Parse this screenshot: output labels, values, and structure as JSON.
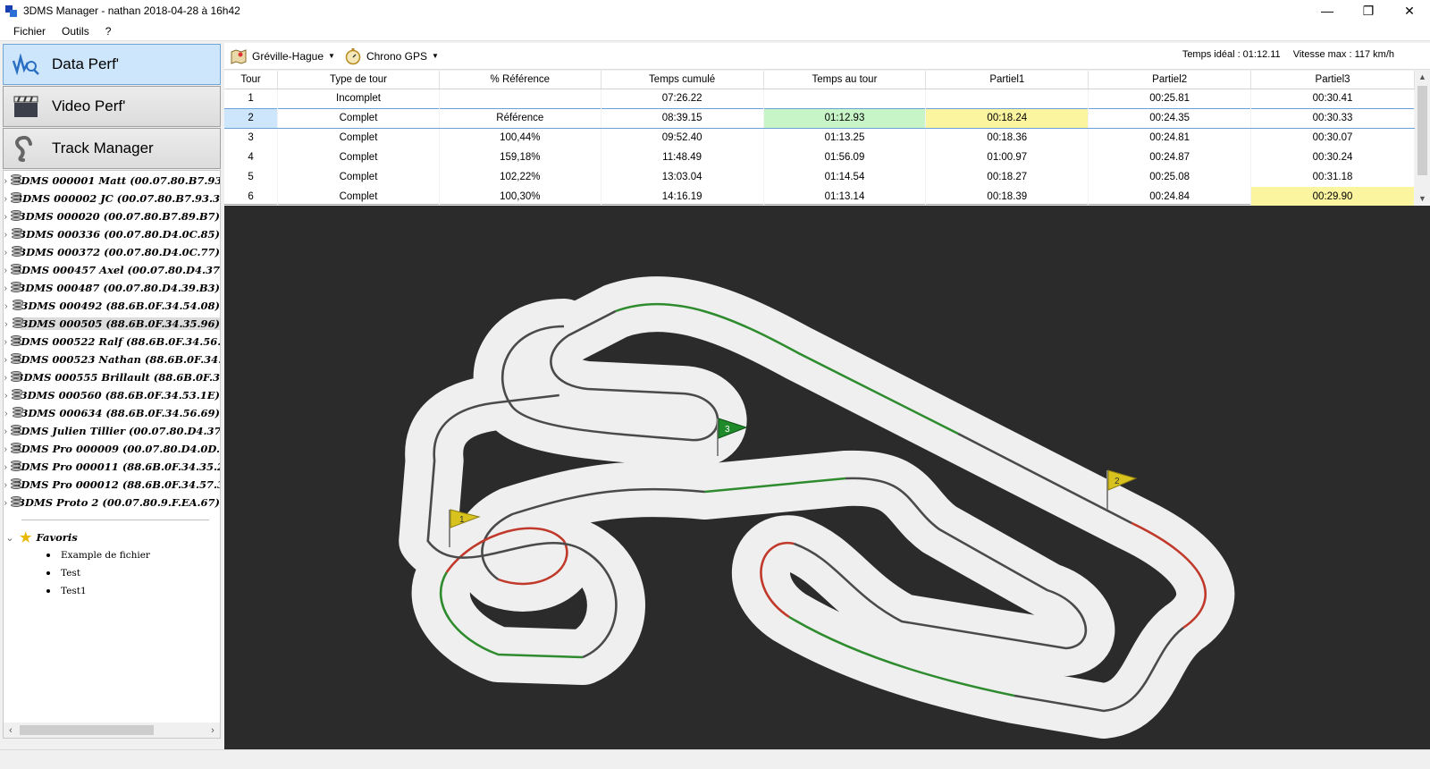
{
  "window": {
    "title": "3DMS Manager - nathan 2018-04-28 à 16h42",
    "minimize": "—",
    "maximize": "❐",
    "close": "✕"
  },
  "menu": [
    "Fichier",
    "Outils",
    "?"
  ],
  "nav": {
    "data_perf": "Data Perf'",
    "video_perf": "Video Perf'",
    "track_manager": "Track Manager",
    "active": "data_perf"
  },
  "devices": [
    "3DMS 000001 Matt (00.07.80.B7.93",
    "3DMS 000002 JC (00.07.80.B7.93.3",
    "3DMS 000020 (00.07.80.B7.89.B7)",
    "3DMS 000336 (00.07.80.D4.0C.85)",
    "3DMS 000372 (00.07.80.D4.0C.77)",
    "3DMS 000457 Axel (00.07.80.D4.37",
    "3DMS 000487 (00.07.80.D4.39.B3)",
    "3DMS 000492 (88.6B.0F.34.54.08)",
    "3DMS 000505 (88.6B.0F.34.35.96)",
    "3DMS 000522 Ralf (88.6B.0F.34.56.",
    "3DMS 000523 Nathan (88.6B.0F.34.",
    "3DMS 000555 Brillault (88.6B.0F.3",
    "3DMS 000560 (88.6B.0F.34.53.1E)",
    "3DMS 000634 (88.6B.0F.34.56.69)",
    "3DMS Julien Tillier (00.07.80.D4.37",
    "3DMS Pro 000009 (00.07.80.D4.0D.",
    "3DMS Pro 000011 (88.6B.0F.34.35.2",
    "3DMS Pro 000012 (88.6B.0F.34.57.3",
    "3DMS Proto 2 (00.07.80.9.F.EA.67)"
  ],
  "selected_device_index": 8,
  "favorites": {
    "label": "Favoris",
    "items": [
      "Example de fichier",
      "Test",
      "Test1"
    ]
  },
  "toolbar": {
    "track": "Gréville-Hague",
    "mode": "Chrono GPS",
    "ideal_time": "Temps idéal : 01:12.11",
    "max_speed": "Vitesse max : 117 km/h"
  },
  "table": {
    "headers": [
      "Tour",
      "Type de tour",
      "% Référence",
      "Temps cumulé",
      "Temps au tour",
      "Partiel1",
      "Partiel2",
      "Partiel3"
    ],
    "rows": [
      [
        "1",
        "Incomplet",
        "",
        "07:26.22",
        "",
        "",
        "00:25.81",
        "00:30.41"
      ],
      [
        "2",
        "Complet",
        "Référence",
        "08:39.15",
        "01:12.93",
        "00:18.24",
        "00:24.35",
        "00:30.33"
      ],
      [
        "3",
        "Complet",
        "100,44%",
        "09:52.40",
        "01:13.25",
        "00:18.36",
        "00:24.81",
        "00:30.07"
      ],
      [
        "4",
        "Complet",
        "159,18%",
        "11:48.49",
        "01:56.09",
        "01:00.97",
        "00:24.87",
        "00:30.24"
      ],
      [
        "5",
        "Complet",
        "102,22%",
        "13:03.04",
        "01:14.54",
        "00:18.27",
        "00:25.08",
        "00:31.18"
      ],
      [
        "6",
        "Complet",
        "100,30%",
        "14:16.19",
        "01:13.14",
        "00:18.39",
        "00:24.84",
        "00:29.90"
      ]
    ],
    "selected_row": 1,
    "highlights": {
      "green": [
        [
          1,
          4
        ]
      ],
      "yellow": [
        [
          1,
          5
        ],
        [
          5,
          7
        ]
      ]
    }
  },
  "map": {
    "flags": [
      {
        "label": "1",
        "color": "#d8c21e"
      },
      {
        "label": "2",
        "color": "#d8c21e"
      },
      {
        "label": "3",
        "color": "#1f8a2a"
      }
    ],
    "colors": {
      "background": "#2b2b2b",
      "track": "#efefef",
      "line_neutral": "#4a4a4a",
      "line_fast": "#2e8b2e",
      "line_slow": "#c0392b"
    }
  }
}
